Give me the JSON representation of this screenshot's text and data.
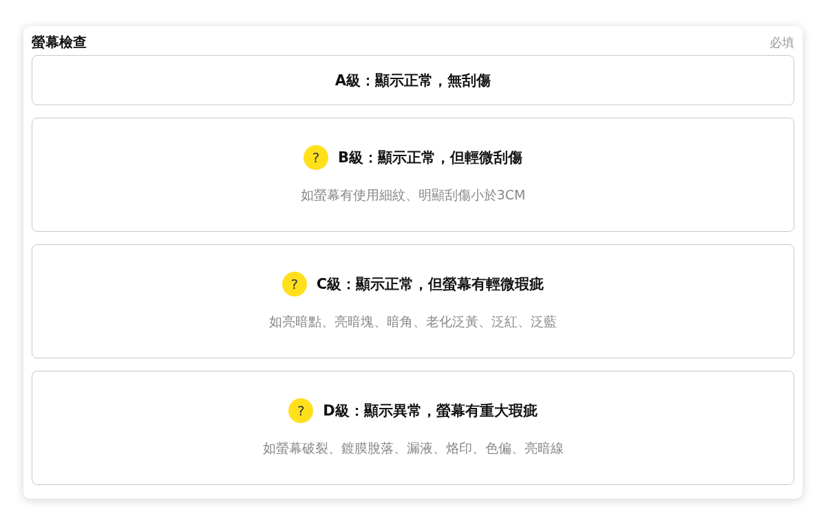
{
  "section": {
    "title": "螢幕檢查",
    "required_label": "必填"
  },
  "options": [
    {
      "label": "A級：顯示正常，無刮傷",
      "selected": false
    },
    {
      "label": "B級：顯示正常，但輕微刮傷",
      "hint_mark": "?",
      "description": "如螢幕有使用細紋、明顯刮傷小於3CM",
      "selected": false
    },
    {
      "label": "C級：顯示正常，但螢幕有輕微瑕疵",
      "hint_mark": "?",
      "description": "如亮暗點、亮暗塊、暗角、老化泛黃、泛紅、泛藍",
      "selected": false
    },
    {
      "label": "D級：顯示異常，螢幕有重大瑕疵",
      "hint_mark": "?",
      "description": "如螢幕破裂、鍍膜脫落、漏液、烙印、色偏、亮暗線",
      "selected": false
    }
  ]
}
